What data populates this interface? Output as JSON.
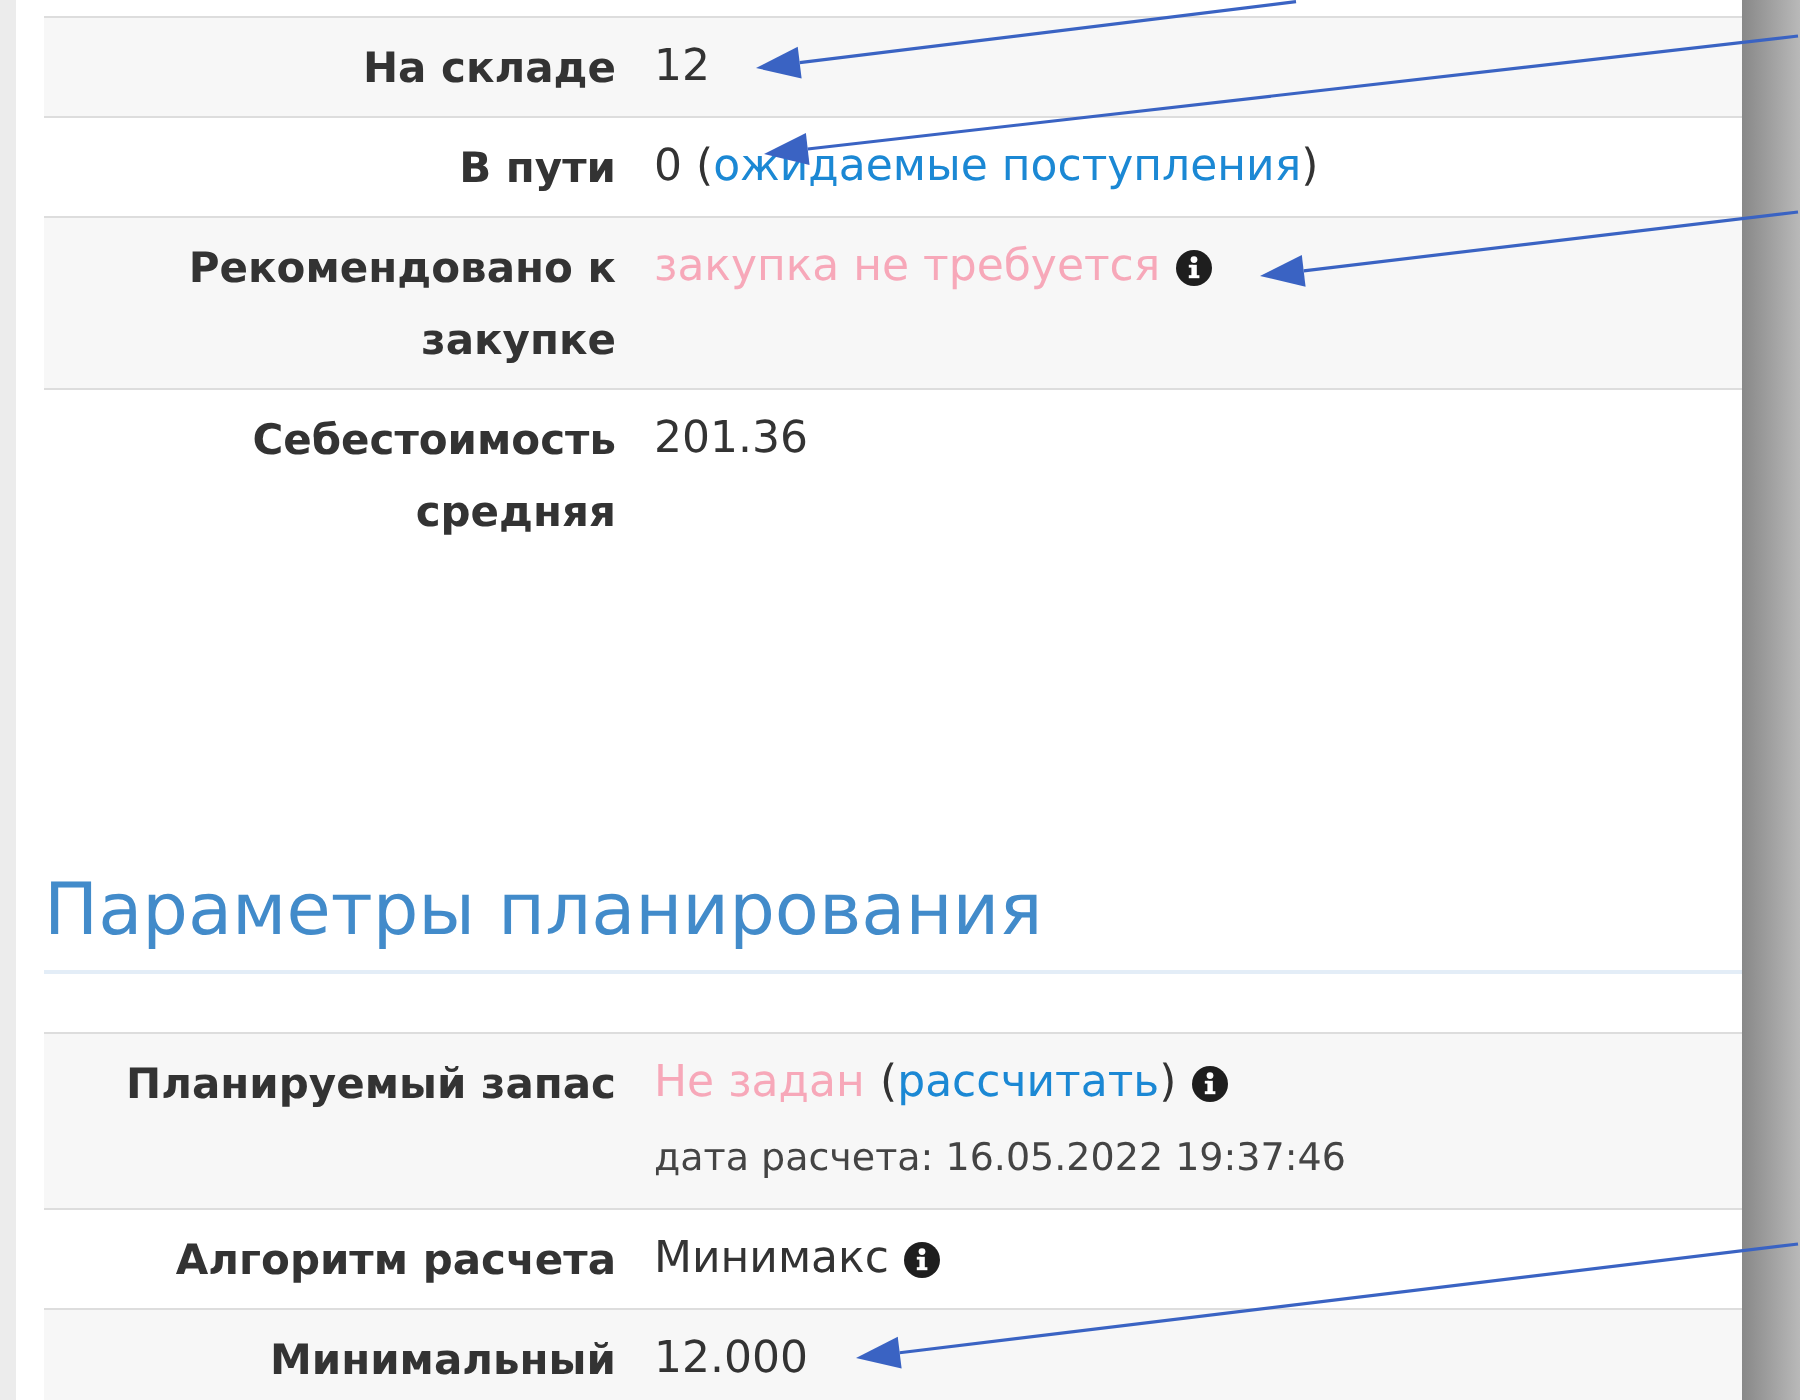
{
  "stock_table": {
    "rows": [
      {
        "label": "На складе",
        "value": [
          {
            "kind": "text",
            "text": "12"
          }
        ],
        "info_icon": false
      },
      {
        "label": "В пути",
        "value": [
          {
            "kind": "text",
            "text": "0 ("
          },
          {
            "kind": "link",
            "text": "ожидаемые поступления"
          },
          {
            "kind": "text",
            "text": ")"
          }
        ],
        "info_icon": false
      },
      {
        "label": "Рекомендовано к закупке",
        "value": [
          {
            "kind": "warning",
            "text": "закупка не требуется"
          }
        ],
        "info_icon": true
      },
      {
        "label": "Себестоимость средняя",
        "value": [
          {
            "kind": "text",
            "text": "201.36"
          }
        ],
        "info_icon": false
      }
    ]
  },
  "planning": {
    "title": "Параметры планирования",
    "rows": [
      {
        "label": "Планируемый запас",
        "value": [
          {
            "kind": "warning",
            "text": "Не задан"
          },
          {
            "kind": "text",
            "text": "("
          },
          {
            "kind": "link",
            "text": "рассчитать"
          },
          {
            "kind": "text",
            "text": ")"
          }
        ],
        "info_icon": true,
        "note": "дата расчета: 16.05.2022 19:37:46"
      },
      {
        "label": "Алгоритм расчета",
        "value": [
          {
            "kind": "text",
            "text": "Минимакс"
          }
        ],
        "info_icon": true
      },
      {
        "label": "Минимальный",
        "value": [
          {
            "kind": "text",
            "text": "12.000"
          }
        ],
        "info_icon": false
      }
    ]
  }
}
